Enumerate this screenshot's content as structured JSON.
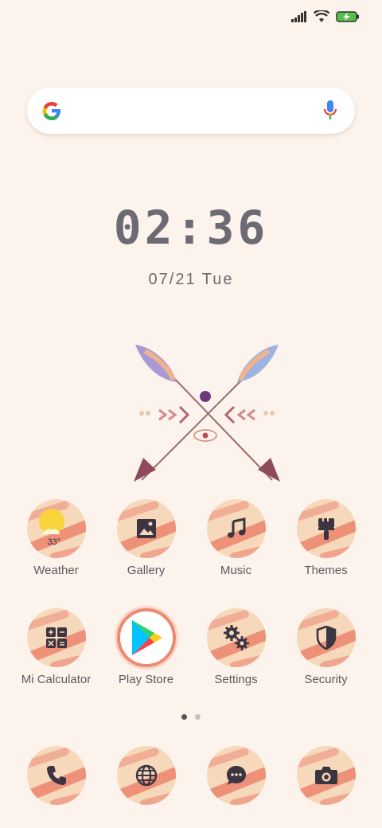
{
  "status_bar": {
    "signal_icon": "cell-signal-icon",
    "wifi_icon": "wifi-icon",
    "battery_icon": "battery-charging-icon"
  },
  "search": {
    "logo": "google-logo",
    "mic_icon": "microphone-icon"
  },
  "clock": {
    "time": "02:36",
    "date": "07/21 Tue"
  },
  "apps_row1": [
    {
      "label": "Weather",
      "temp": "33°"
    },
    {
      "label": "Gallery"
    },
    {
      "label": "Music"
    },
    {
      "label": "Themes"
    }
  ],
  "apps_row2": [
    {
      "label": "Mi Calculator"
    },
    {
      "label": "Play Store"
    },
    {
      "label": "Settings"
    },
    {
      "label": "Security"
    }
  ],
  "dock": [
    {
      "icon": "phone-icon"
    },
    {
      "icon": "browser-globe-icon"
    },
    {
      "icon": "messages-icon"
    },
    {
      "icon": "camera-icon"
    }
  ],
  "pager": {
    "pages": 2,
    "active": 1
  },
  "colors": {
    "background": "#fdf3ed",
    "accent": "#ec8a72",
    "icon_base": "#f6d8bb",
    "clock_text": "#6c6a72"
  }
}
